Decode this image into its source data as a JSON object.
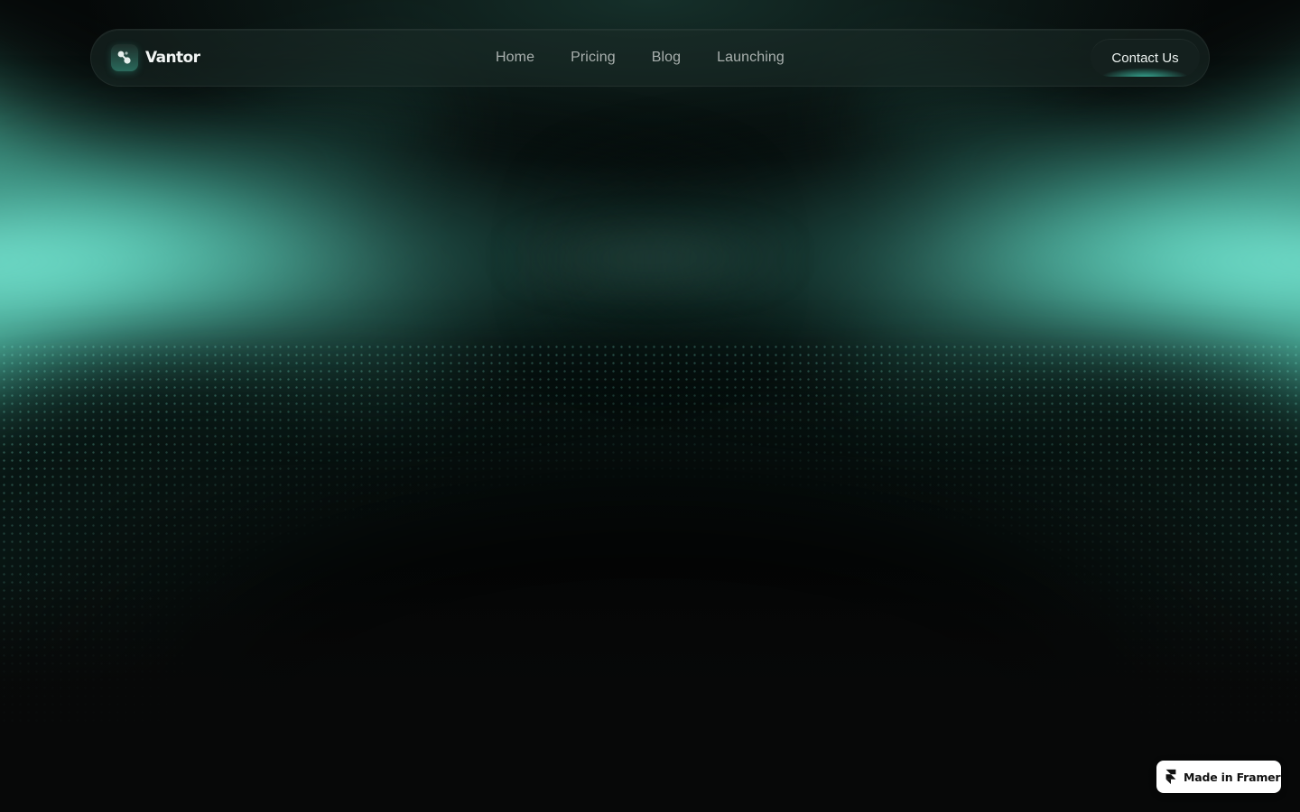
{
  "brand": {
    "name": "Vantor",
    "logo_icon": "molecule-icon"
  },
  "nav": {
    "items": [
      {
        "label": "Home"
      },
      {
        "label": "Pricing"
      },
      {
        "label": "Blog"
      },
      {
        "label": "Launching"
      }
    ],
    "cta_label": "Contact Us"
  },
  "badge": {
    "label": "Made in Framer",
    "icon": "framer-logo-icon"
  },
  "colors": {
    "background": "#070808",
    "accent": "#7ef5dc",
    "nav_text": "#a9b0ae",
    "cta_background": "#14201e"
  }
}
